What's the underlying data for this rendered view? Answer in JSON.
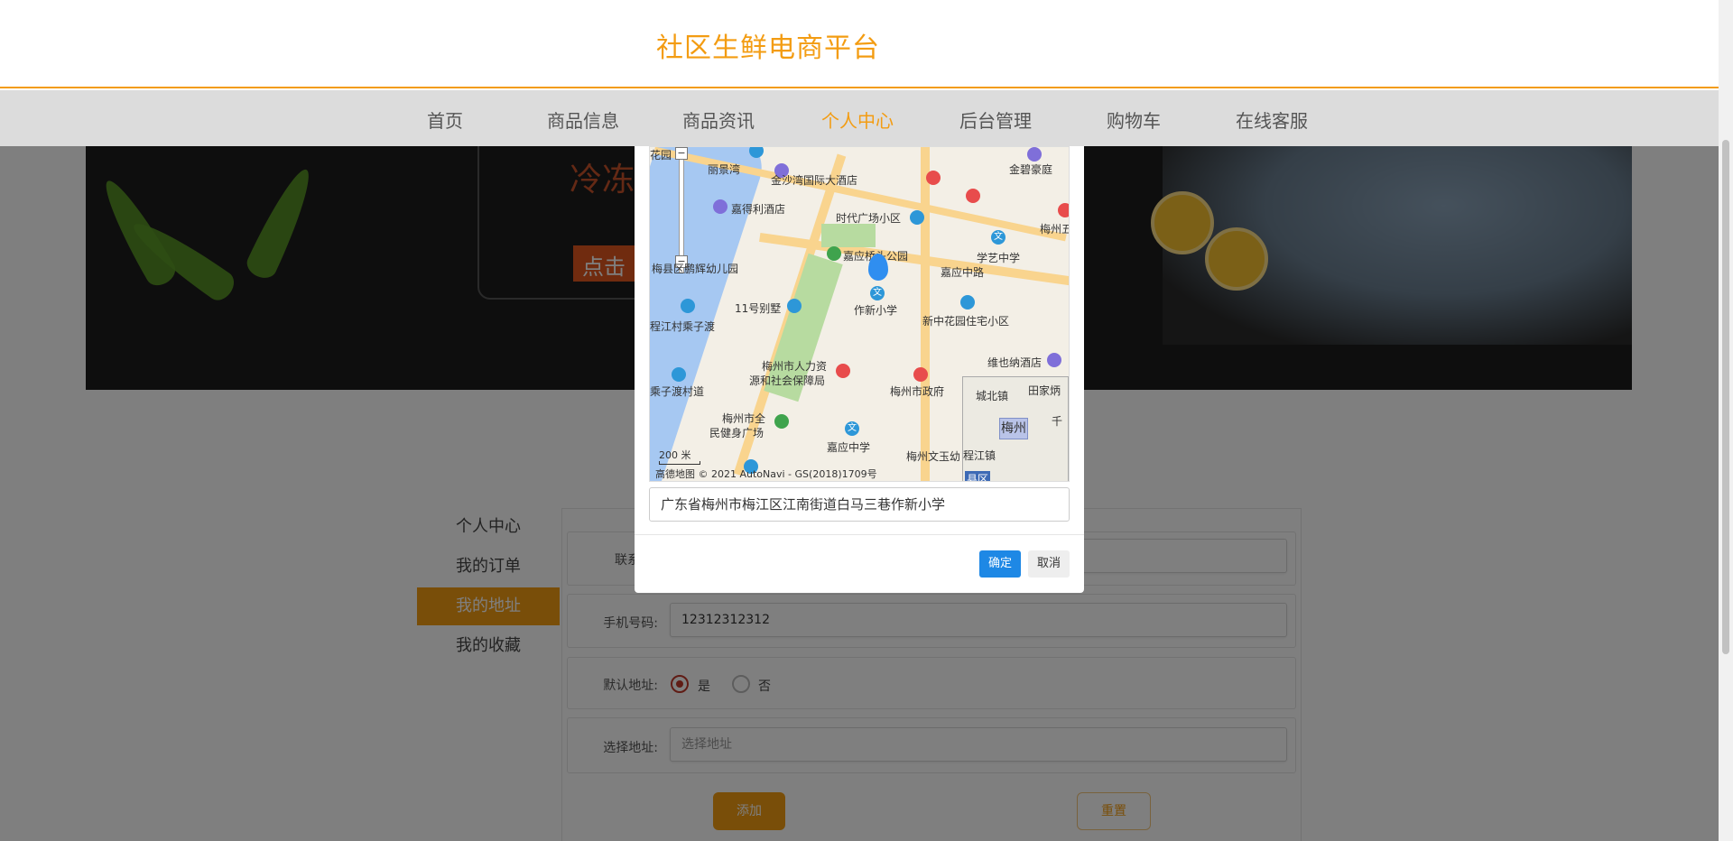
{
  "header": {
    "title": "社区生鲜电商平台"
  },
  "nav": {
    "items": [
      {
        "label": "首页"
      },
      {
        "label": "商品信息"
      },
      {
        "label": "商品资讯"
      },
      {
        "label": "个人中心"
      },
      {
        "label": "后台管理"
      },
      {
        "label": "购物车"
      },
      {
        "label": "在线客服"
      }
    ],
    "active": "个人中心"
  },
  "banner": {
    "promo_text": "冷冻",
    "promo_button": "点击"
  },
  "sidebar": {
    "items": [
      {
        "label": "个人中心"
      },
      {
        "label": "我的订单"
      },
      {
        "label": "我的地址"
      },
      {
        "label": "我的收藏"
      }
    ],
    "active": "我的地址"
  },
  "form": {
    "contact_label": "联系",
    "phone_label": "手机号码:",
    "phone_value": "12312312312",
    "default_label": "默认地址:",
    "default_yes": "是",
    "default_no": "否",
    "address_label": "选择地址:",
    "address_placeholder": "选择地址",
    "add_button": "添加",
    "reset_button": "重置"
  },
  "modal": {
    "address_value": "广东省梅州市梅江区江南街道白马三巷作新小学",
    "ok_button": "确定",
    "cancel_button": "取消",
    "map": {
      "labels": [
        "丽景湾",
        "金沙湾国际大酒店",
        "金碧豪庭",
        "嘉得利酒店",
        "时代广场小区",
        "梅州五",
        "学艺中学",
        "梅县区鹏辉幼儿园",
        "嘉应桥头公园",
        "嘉应中路",
        "11号别墅",
        "作新小学",
        "新中花园住宅小区",
        "程江村乘子渡",
        "梅州市人力资",
        "源和社会保障局",
        "梅州市政府",
        "维也纳酒店",
        "乘子渡村道",
        "梅州市全",
        "民健身广场",
        "嘉应中学",
        "梅州文玉幼",
        "城北镇",
        "田家炳",
        "梅州",
        "花园",
        "江",
        "千",
        "程江镇",
        "县区"
      ],
      "scale": "200 米",
      "brand": "高德地图",
      "copyright": "© 2021 AutoNavi - GS(2018)1709号"
    }
  }
}
